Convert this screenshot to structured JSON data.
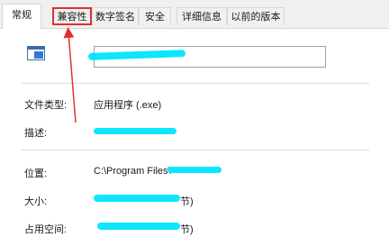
{
  "tabs": [
    {
      "label": "常规"
    },
    {
      "label": "兼容性"
    },
    {
      "label": "数字签名"
    },
    {
      "label": "安全"
    },
    {
      "label": "详细信息"
    },
    {
      "label": "以前的版本"
    }
  ],
  "properties": {
    "file_type_label": "文件类型:",
    "file_type_value": "应用程序 (.exe)",
    "description_label": "描述:",
    "location_label": "位置:",
    "location_value": "C:\\Program Files\\",
    "size_label": "大小:",
    "size_value_suffix": "节)",
    "disk_size_label": "占用空间:",
    "disk_size_value_suffix": "节)"
  },
  "colors": {
    "redaction": "#00e5ff",
    "annotation": "#e03131"
  }
}
